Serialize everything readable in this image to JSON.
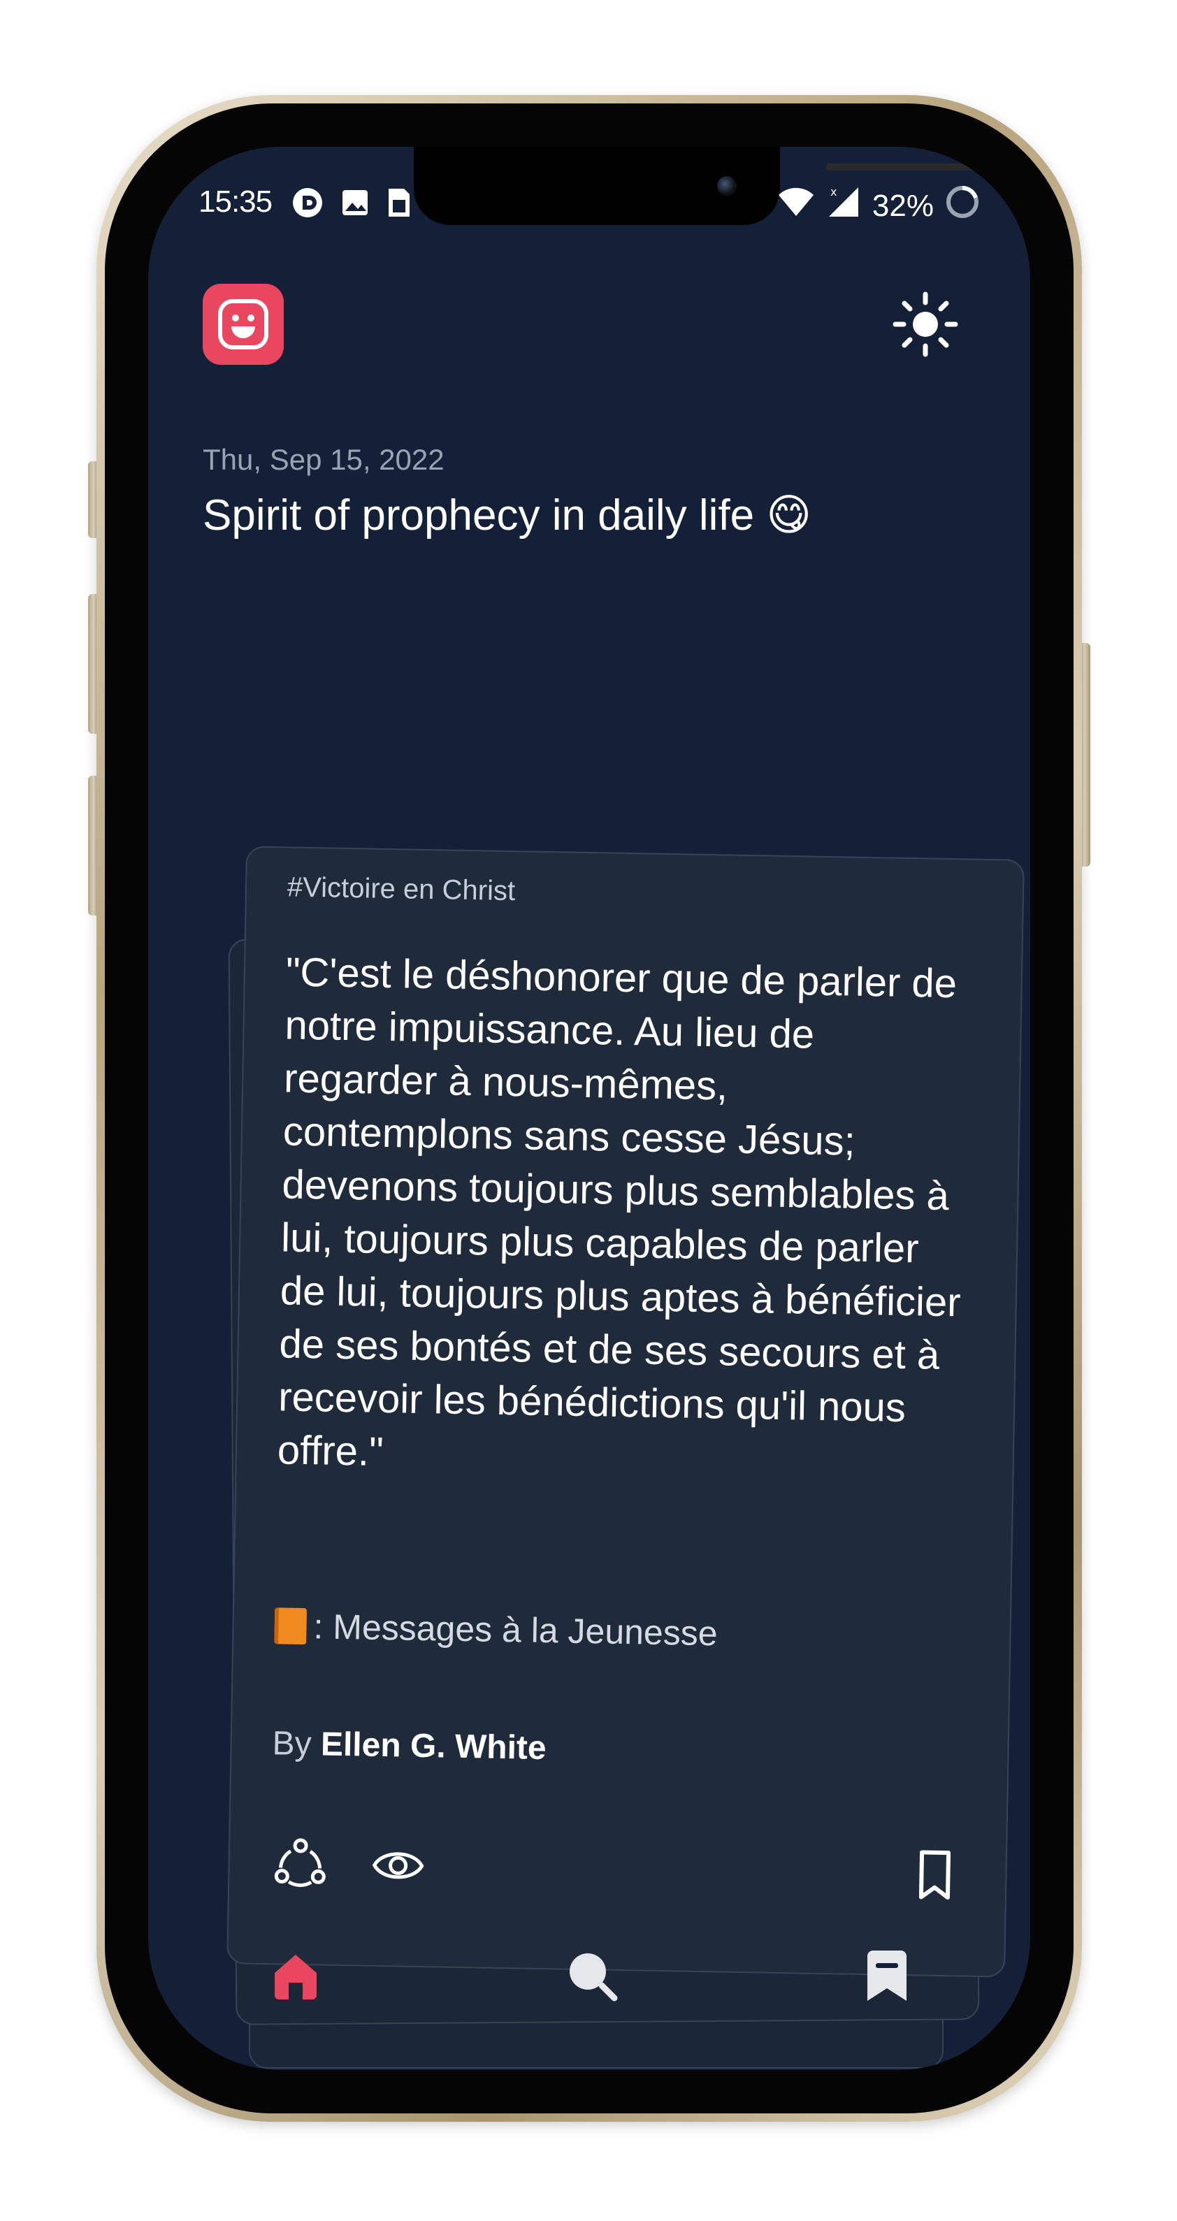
{
  "status_bar": {
    "time": "15:35",
    "battery": "32%",
    "icons": [
      "notification-icon",
      "image-icon",
      "sim-icon",
      "wifi-icon",
      "signal-icon",
      "battery-icon"
    ]
  },
  "header": {
    "logo_icon": "smiley-face-icon",
    "theme_icon": "sun-icon",
    "date": "Thu, Sep 15, 2022",
    "title": "Spirit of prophecy in daily life 😋"
  },
  "card": {
    "tag": "#Victoire en Christ",
    "quote": "\"C'est le déshonorer que de parler de notre impuissance. Au lieu de regarder à nous-mêmes, contemplons sans cesse Jésus; devenons toujours plus semblables à lui, toujours plus capables de parler de lui, toujours plus aptes à bénéficier de ses bontés et de ses secours et à recevoir les bénédictions qu'il nous offre.\"",
    "source_prefix": ": Messages à la Jeunesse",
    "author_prefix": "By",
    "author_name": "Ellen G. White",
    "actions": [
      "share-icon",
      "eye-icon",
      "bookmark-icon"
    ]
  },
  "bottom_nav": {
    "items": [
      "home-icon",
      "search-icon",
      "bookmarks-icon"
    ],
    "active": "home-icon"
  },
  "colors": {
    "background": "#132038",
    "card": "#1f2a3b",
    "accent": "#e8475f",
    "muted_text": "#9aa3b2"
  }
}
